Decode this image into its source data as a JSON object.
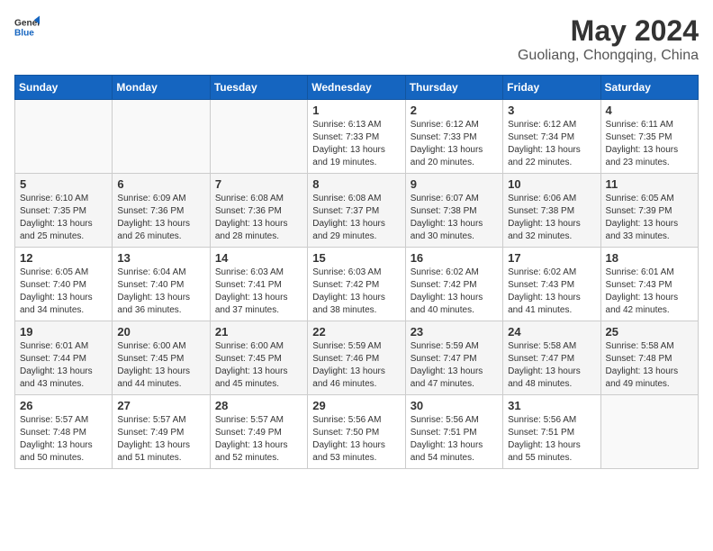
{
  "header": {
    "logo_line1": "General",
    "logo_line2": "Blue",
    "month": "May 2024",
    "location": "Guoliang, Chongqing, China"
  },
  "weekdays": [
    "Sunday",
    "Monday",
    "Tuesday",
    "Wednesday",
    "Thursday",
    "Friday",
    "Saturday"
  ],
  "weeks": [
    [
      {
        "day": "",
        "info": ""
      },
      {
        "day": "",
        "info": ""
      },
      {
        "day": "",
        "info": ""
      },
      {
        "day": "1",
        "info": "Sunrise: 6:13 AM\nSunset: 7:33 PM\nDaylight: 13 hours\nand 19 minutes."
      },
      {
        "day": "2",
        "info": "Sunrise: 6:12 AM\nSunset: 7:33 PM\nDaylight: 13 hours\nand 20 minutes."
      },
      {
        "day": "3",
        "info": "Sunrise: 6:12 AM\nSunset: 7:34 PM\nDaylight: 13 hours\nand 22 minutes."
      },
      {
        "day": "4",
        "info": "Sunrise: 6:11 AM\nSunset: 7:35 PM\nDaylight: 13 hours\nand 23 minutes."
      }
    ],
    [
      {
        "day": "5",
        "info": "Sunrise: 6:10 AM\nSunset: 7:35 PM\nDaylight: 13 hours\nand 25 minutes."
      },
      {
        "day": "6",
        "info": "Sunrise: 6:09 AM\nSunset: 7:36 PM\nDaylight: 13 hours\nand 26 minutes."
      },
      {
        "day": "7",
        "info": "Sunrise: 6:08 AM\nSunset: 7:36 PM\nDaylight: 13 hours\nand 28 minutes."
      },
      {
        "day": "8",
        "info": "Sunrise: 6:08 AM\nSunset: 7:37 PM\nDaylight: 13 hours\nand 29 minutes."
      },
      {
        "day": "9",
        "info": "Sunrise: 6:07 AM\nSunset: 7:38 PM\nDaylight: 13 hours\nand 30 minutes."
      },
      {
        "day": "10",
        "info": "Sunrise: 6:06 AM\nSunset: 7:38 PM\nDaylight: 13 hours\nand 32 minutes."
      },
      {
        "day": "11",
        "info": "Sunrise: 6:05 AM\nSunset: 7:39 PM\nDaylight: 13 hours\nand 33 minutes."
      }
    ],
    [
      {
        "day": "12",
        "info": "Sunrise: 6:05 AM\nSunset: 7:40 PM\nDaylight: 13 hours\nand 34 minutes."
      },
      {
        "day": "13",
        "info": "Sunrise: 6:04 AM\nSunset: 7:40 PM\nDaylight: 13 hours\nand 36 minutes."
      },
      {
        "day": "14",
        "info": "Sunrise: 6:03 AM\nSunset: 7:41 PM\nDaylight: 13 hours\nand 37 minutes."
      },
      {
        "day": "15",
        "info": "Sunrise: 6:03 AM\nSunset: 7:42 PM\nDaylight: 13 hours\nand 38 minutes."
      },
      {
        "day": "16",
        "info": "Sunrise: 6:02 AM\nSunset: 7:42 PM\nDaylight: 13 hours\nand 40 minutes."
      },
      {
        "day": "17",
        "info": "Sunrise: 6:02 AM\nSunset: 7:43 PM\nDaylight: 13 hours\nand 41 minutes."
      },
      {
        "day": "18",
        "info": "Sunrise: 6:01 AM\nSunset: 7:43 PM\nDaylight: 13 hours\nand 42 minutes."
      }
    ],
    [
      {
        "day": "19",
        "info": "Sunrise: 6:01 AM\nSunset: 7:44 PM\nDaylight: 13 hours\nand 43 minutes."
      },
      {
        "day": "20",
        "info": "Sunrise: 6:00 AM\nSunset: 7:45 PM\nDaylight: 13 hours\nand 44 minutes."
      },
      {
        "day": "21",
        "info": "Sunrise: 6:00 AM\nSunset: 7:45 PM\nDaylight: 13 hours\nand 45 minutes."
      },
      {
        "day": "22",
        "info": "Sunrise: 5:59 AM\nSunset: 7:46 PM\nDaylight: 13 hours\nand 46 minutes."
      },
      {
        "day": "23",
        "info": "Sunrise: 5:59 AM\nSunset: 7:47 PM\nDaylight: 13 hours\nand 47 minutes."
      },
      {
        "day": "24",
        "info": "Sunrise: 5:58 AM\nSunset: 7:47 PM\nDaylight: 13 hours\nand 48 minutes."
      },
      {
        "day": "25",
        "info": "Sunrise: 5:58 AM\nSunset: 7:48 PM\nDaylight: 13 hours\nand 49 minutes."
      }
    ],
    [
      {
        "day": "26",
        "info": "Sunrise: 5:57 AM\nSunset: 7:48 PM\nDaylight: 13 hours\nand 50 minutes."
      },
      {
        "day": "27",
        "info": "Sunrise: 5:57 AM\nSunset: 7:49 PM\nDaylight: 13 hours\nand 51 minutes."
      },
      {
        "day": "28",
        "info": "Sunrise: 5:57 AM\nSunset: 7:49 PM\nDaylight: 13 hours\nand 52 minutes."
      },
      {
        "day": "29",
        "info": "Sunrise: 5:56 AM\nSunset: 7:50 PM\nDaylight: 13 hours\nand 53 minutes."
      },
      {
        "day": "30",
        "info": "Sunrise: 5:56 AM\nSunset: 7:51 PM\nDaylight: 13 hours\nand 54 minutes."
      },
      {
        "day": "31",
        "info": "Sunrise: 5:56 AM\nSunset: 7:51 PM\nDaylight: 13 hours\nand 55 minutes."
      },
      {
        "day": "",
        "info": ""
      }
    ]
  ]
}
